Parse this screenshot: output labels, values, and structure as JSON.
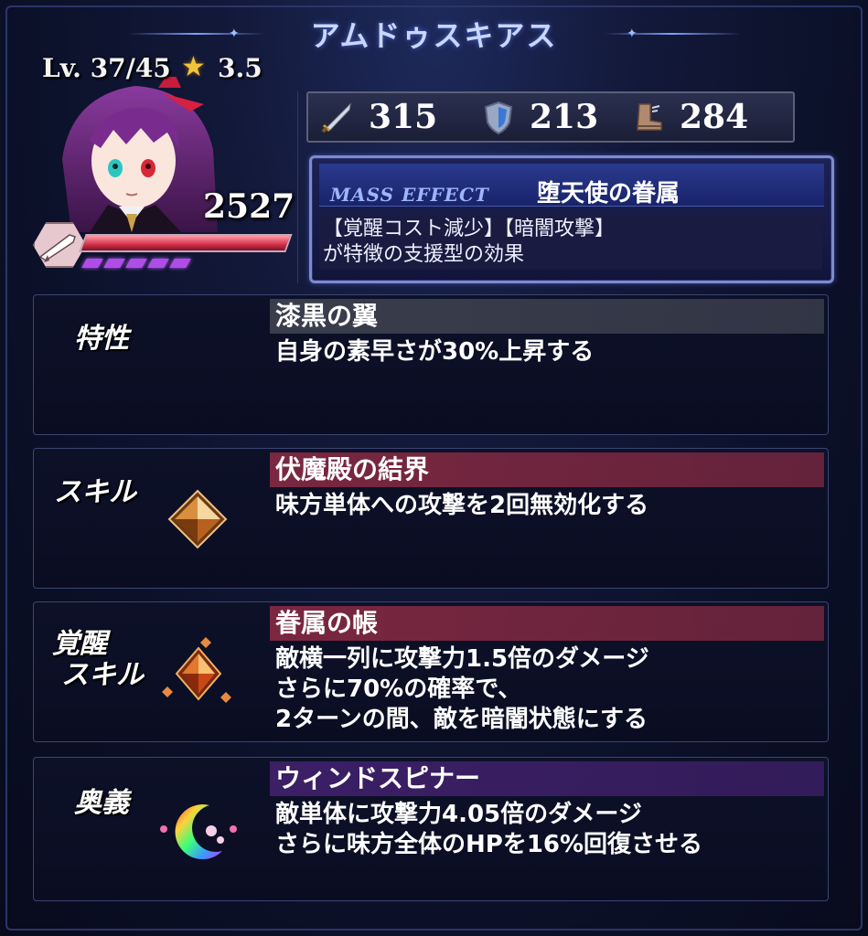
{
  "header": {
    "character_name": "アムドゥスキアス"
  },
  "unit": {
    "level": "Lv. 37/45",
    "rarity": "3.5",
    "power": "2527",
    "hp_fraction": 1.0,
    "pip_count": 5
  },
  "stats": {
    "attack": "315",
    "defense": "213",
    "speed": "284",
    "attack_icon": "sword-icon",
    "defense_icon": "shield-icon",
    "speed_icon": "boot-icon"
  },
  "mass_effect": {
    "tag": "MASS EFFECT",
    "name": "堕天使の眷属",
    "description": "【覚醒コスト減少】【暗闇攻撃】\nが特徴の支援型の効果"
  },
  "sections": {
    "trait": {
      "label": "特性",
      "title": "漆黒の翼",
      "body": "自身の素早さが30%上昇する",
      "header_color": "#3a3e4c"
    },
    "skill": {
      "label": "スキル",
      "title": "伏魔殿の結界",
      "body": "味方単体への攻撃を2回無効化する",
      "header_color": "#7a2740"
    },
    "awaken_skill": {
      "label_line1": "覚醒",
      "label_line2": "スキル",
      "title": "眷属の帳",
      "body": "敵横一列に攻撃力1.5倍のダメージ\nさらに70%の確率で、\n2ターンの間、敵を暗闇状態にする",
      "header_color": "#7a2740"
    },
    "ultimate": {
      "label": "奥義",
      "title": "ウィンドスピナー",
      "body": "敵単体に攻撃力4.05倍のダメージ\nさらに味方全体のHPを16%回復させる",
      "header_color": "#3c1f66"
    }
  }
}
